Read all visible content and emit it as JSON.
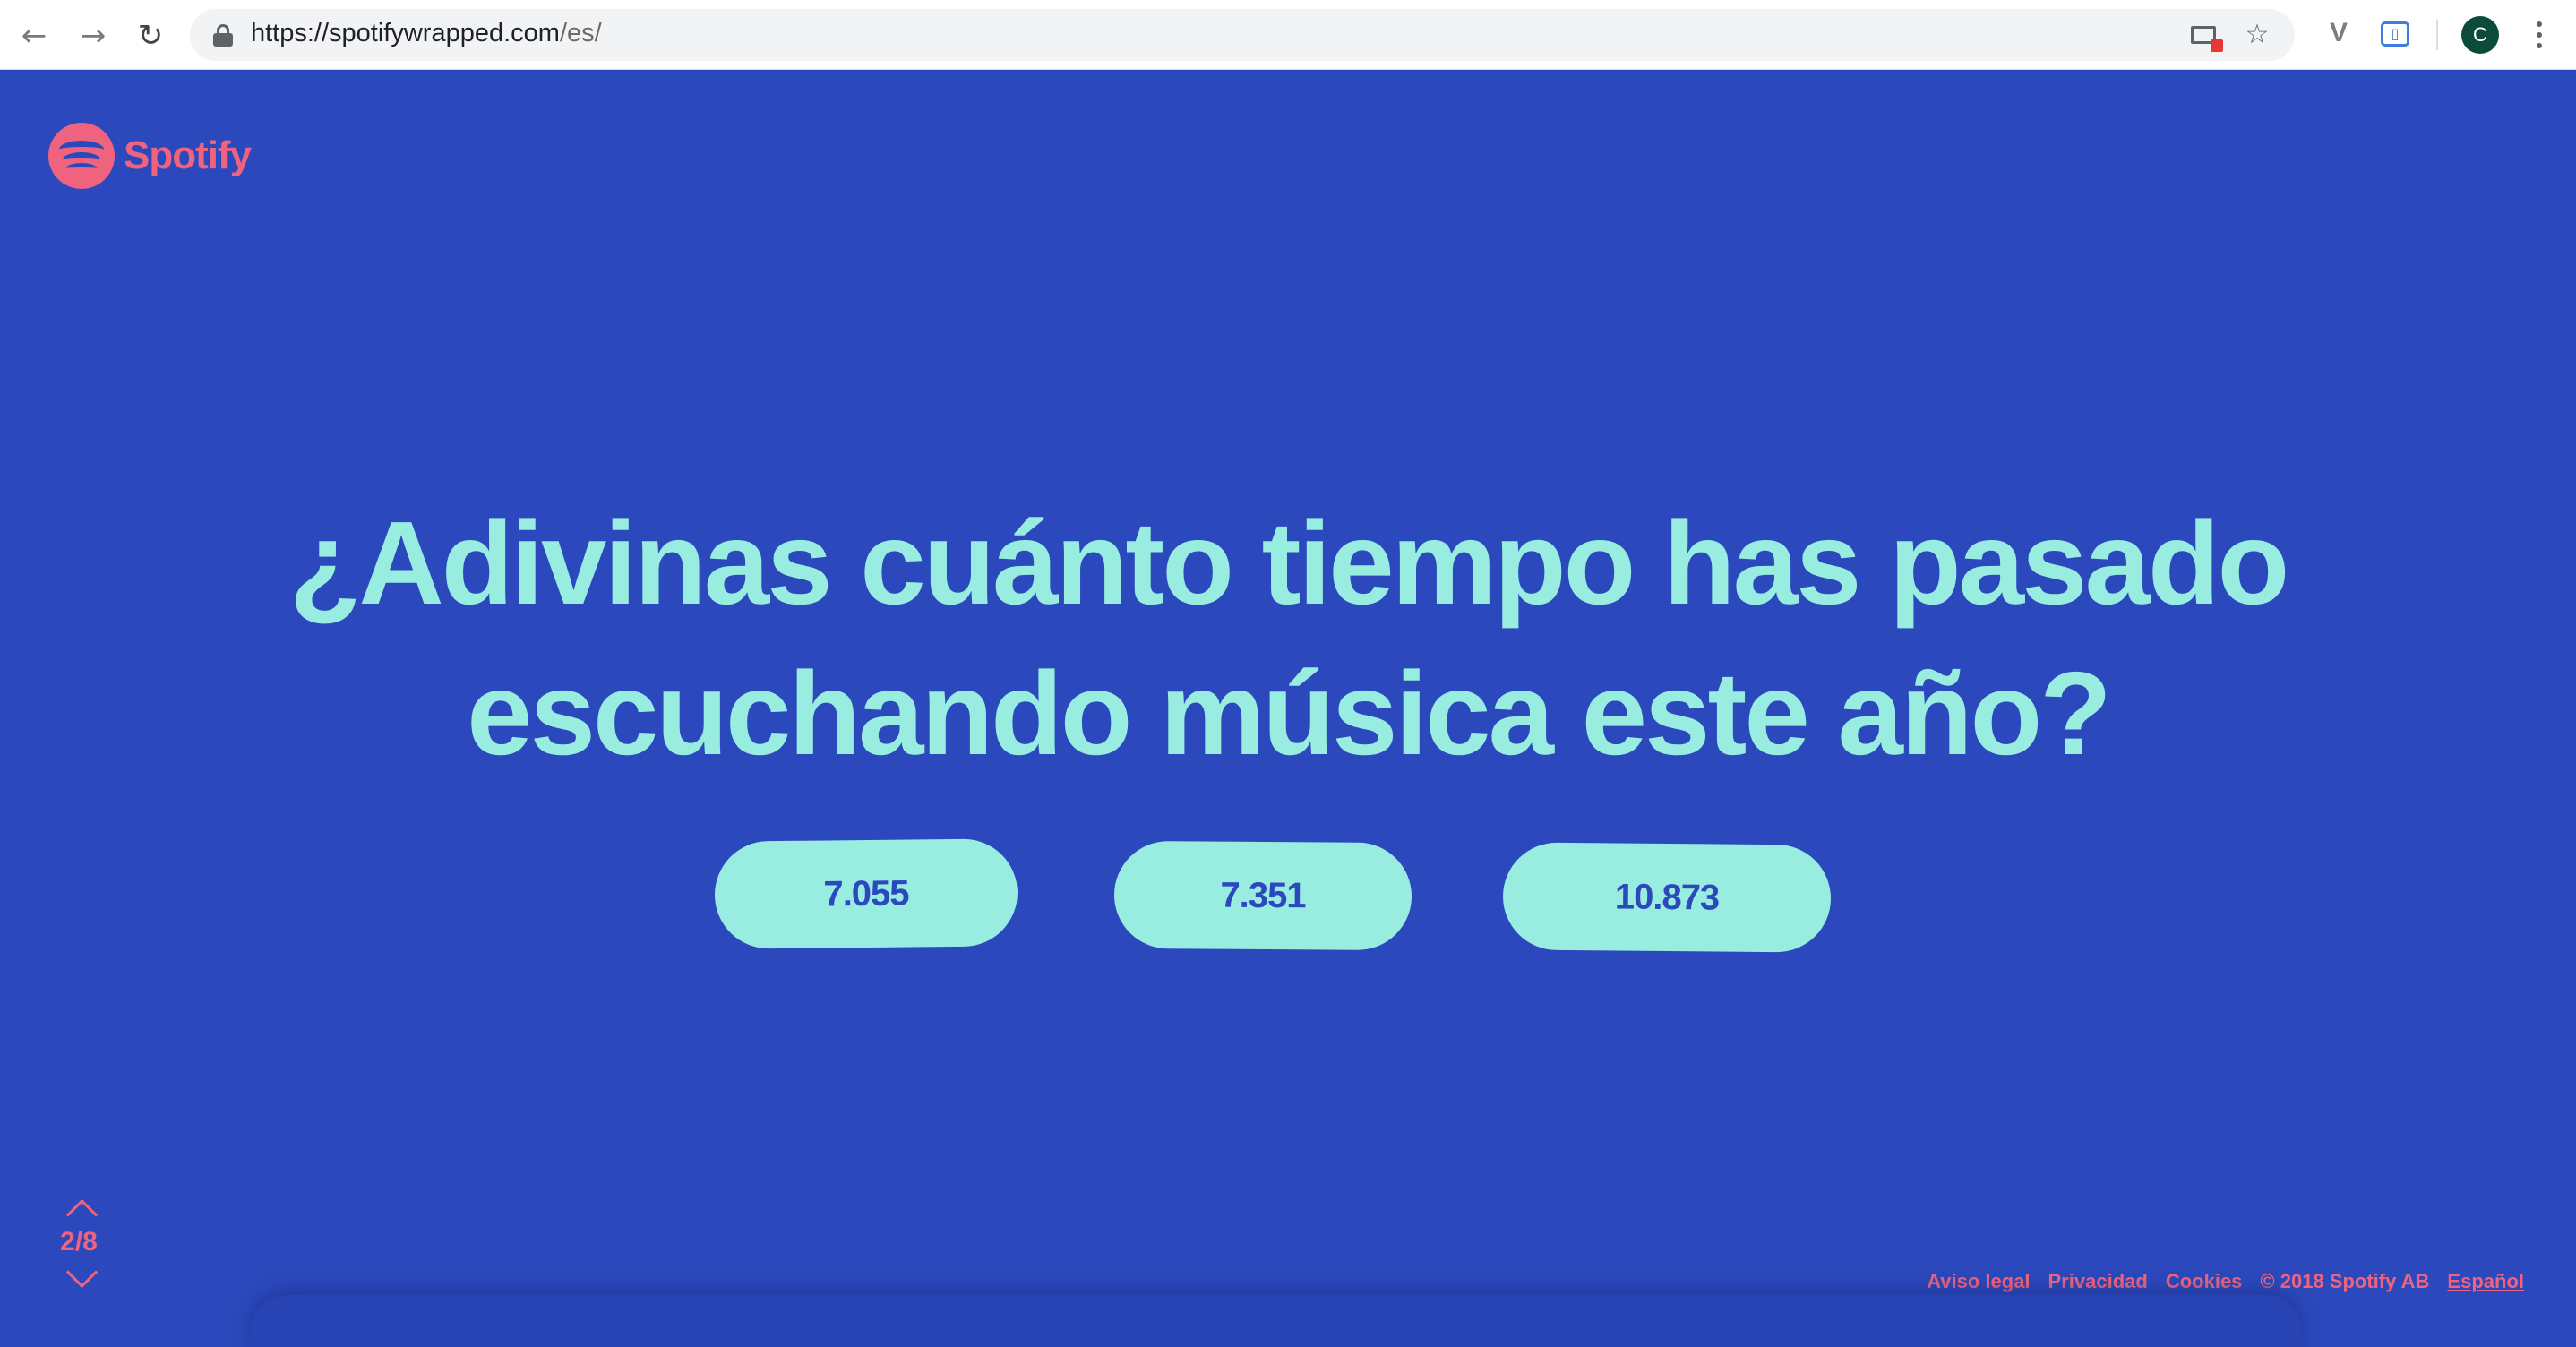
{
  "browser": {
    "url_host": "https://spotifywrapped.com",
    "url_path": "/es/",
    "nav_icons": [
      "back-arrow-icon",
      "forward-arrow-icon",
      "reload-icon"
    ],
    "omnibox_icons": [
      "lock-icon",
      "cast-blocked-icon",
      "star-icon"
    ],
    "extension_icons": [
      "v-extension-icon",
      "box-extension-icon"
    ],
    "profile_initial": "C",
    "colors": {
      "profile_bg": "#0c4a3a"
    }
  },
  "page": {
    "brand": "Spotify",
    "headline_line1": "¿Adivinas cuánto tiempo has pasado",
    "headline_line2": "escuchando música este año?",
    "answers": [
      "7.055",
      "7.351",
      "10.873"
    ],
    "pager": {
      "current": "2/8",
      "icons": [
        "chevron-up-icon",
        "chevron-down-icon"
      ]
    },
    "footer": {
      "legal": "Aviso legal",
      "privacy": "Privacidad",
      "cookies": "Cookies",
      "copyright": "© 2018 Spotify AB",
      "language": "Español"
    },
    "colors": {
      "background": "#2b49bc",
      "accent": "#98ede0",
      "brand_pink": "#f0637f"
    }
  }
}
